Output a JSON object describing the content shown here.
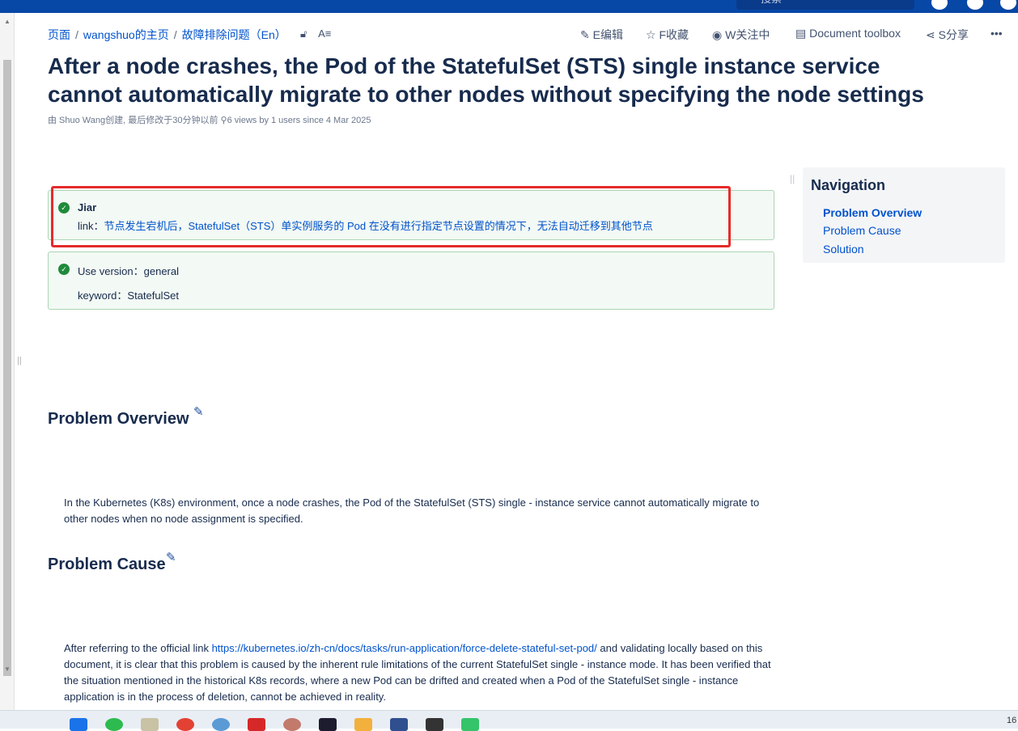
{
  "search": {
    "placeholder": "搜索"
  },
  "breadcrumb": {
    "items": [
      "页面",
      "wangshuo的主页",
      "故障排除问题（En）"
    ],
    "sep": "/"
  },
  "actions": {
    "edit": "E编辑",
    "favorite": "F收藏",
    "watch": "W关注中",
    "toolbox": "Document toolbox",
    "share": "S分享",
    "more": "•••"
  },
  "page": {
    "title": "After a node crashes, the Pod of the StatefulSet (STS) single instance service cannot automatically migrate to other nodes without specifying the node settings",
    "meta": "由 Shuo Wang创建, 最后修改于30分钟以前  ⚲6 views by 1 users since 4 Mar 2025"
  },
  "panel1": {
    "name": "Jiar",
    "link_label": "link：",
    "link_text": "节点发生宕机后，StatefulSet（STS）单实例服务的 Pod 在没有进行指定节点设置的情况下，无法自动迁移到其他节点"
  },
  "panel2": {
    "version": "Use version：general",
    "keyword": "keyword：StatefulSet"
  },
  "navigation": {
    "title": "Navigation",
    "items": [
      "Problem Overview",
      "Problem Cause",
      "Solution"
    ]
  },
  "sections": {
    "overview": {
      "heading": "Problem Overview",
      "text": "In the Kubernetes (K8s) environment, once a node crashes, the Pod of the StatefulSet (STS) single - instance service cannot automatically migrate to other nodes when no node assignment is specified."
    },
    "cause": {
      "heading": "Problem Cause",
      "text_before": "After referring to the official link ",
      "link": "https://kubernetes.io/zh-cn/docs/tasks/run-application/force-delete-stateful-set-pod/",
      "text_after": " and validating locally based on this document, it is clear that this problem is caused by the inherent rule limitations of the current StatefulSet single - instance mode. It has been verified that the situation mentioned in the historical K8s records, where a new Pod can be drifted and created when a Pod of the StatefulSet single - instance application is in the process of deletion, cannot be achieved in reality."
    }
  },
  "taskbar": {
    "clock": "16"
  },
  "colors": {
    "accent": "#0052cc",
    "topbar": "#0747a6",
    "panel_bg": "#f3f9f4",
    "panel_border": "#abd5b5",
    "highlight": "#e52b2b"
  }
}
